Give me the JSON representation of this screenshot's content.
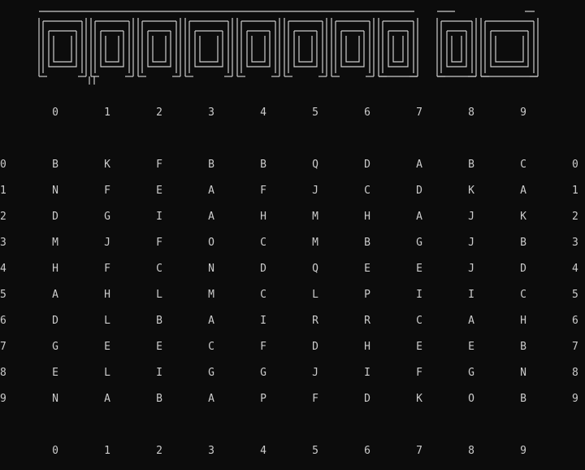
{
  "banner_text": "Mahjong 2d",
  "column_indices": [
    "0",
    "1",
    "2",
    "3",
    "4",
    "5",
    "6",
    "7",
    "8",
    "9"
  ],
  "row_indices": [
    "0",
    "1",
    "2",
    "3",
    "4",
    "5",
    "6",
    "7",
    "8",
    "9"
  ],
  "board": [
    [
      "B",
      "K",
      "F",
      "B",
      "B",
      "Q",
      "D",
      "A",
      "B",
      "C"
    ],
    [
      "N",
      "F",
      "E",
      "A",
      "F",
      "J",
      "C",
      "D",
      "K",
      "A"
    ],
    [
      "D",
      "G",
      "I",
      "A",
      "H",
      "M",
      "H",
      "A",
      "J",
      "K"
    ],
    [
      "M",
      "J",
      "F",
      "O",
      "C",
      "M",
      "B",
      "G",
      "J",
      "B"
    ],
    [
      "H",
      "F",
      "C",
      "N",
      "D",
      "Q",
      "E",
      "E",
      "J",
      "D"
    ],
    [
      "A",
      "H",
      "L",
      "M",
      "C",
      "L",
      "P",
      "I",
      "I",
      "C"
    ],
    [
      "D",
      "L",
      "B",
      "A",
      "I",
      "R",
      "R",
      "C",
      "A",
      "H"
    ],
    [
      "G",
      "E",
      "E",
      "C",
      "F",
      "D",
      "H",
      "E",
      "E",
      "B"
    ],
    [
      "E",
      "L",
      "I",
      "G",
      "G",
      "J",
      "I",
      "F",
      "G",
      "N"
    ],
    [
      "N",
      "A",
      "B",
      "A",
      "P",
      "F",
      "D",
      "K",
      "O",
      "B"
    ]
  ],
  "colors": {
    "background": "#0c0c0c",
    "text": "#cccccc"
  }
}
